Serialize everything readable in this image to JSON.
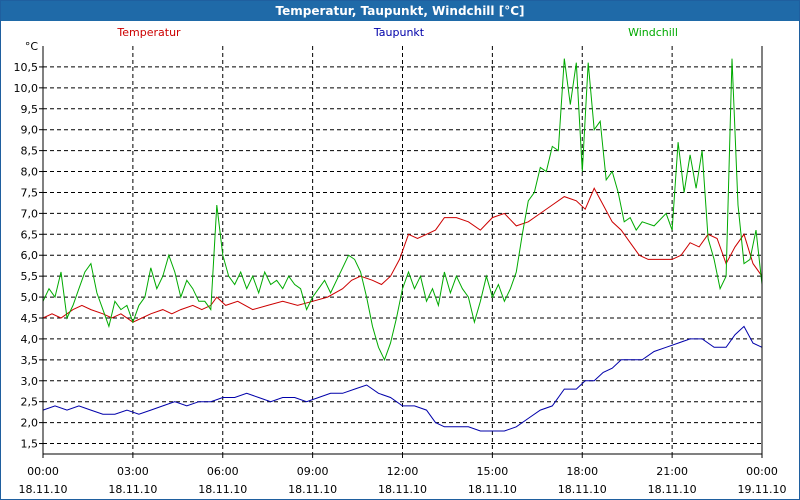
{
  "window_title": "Temperatur, Taupunkt, Windchill [°C]",
  "chart_data": {
    "type": "line",
    "title": "Temperatur, Taupunkt, Windchill [°C]",
    "ylabel": "°C",
    "ylim": [
      1.25,
      11.0
    ],
    "yticks": [
      1.5,
      2.0,
      2.5,
      3.0,
      3.5,
      4.0,
      4.5,
      5.0,
      5.5,
      6.0,
      6.5,
      7.0,
      7.5,
      8.0,
      8.5,
      9.0,
      9.5,
      10.0,
      10.5
    ],
    "ytick_labels": [
      "1,5",
      "2,0",
      "2,5",
      "3,0",
      "3,5",
      "4,0",
      "4,5",
      "5,0",
      "5,5",
      "6,0",
      "6,5",
      "7,0",
      "7,5",
      "8,0",
      "8,5",
      "9,0",
      "9,5",
      "10,0",
      "10,5"
    ],
    "xlim_hours": [
      0,
      24
    ],
    "xticks": [
      {
        "h": 0,
        "time": "00:00",
        "date": "18.11.10"
      },
      {
        "h": 3,
        "time": "03:00",
        "date": "18.11.10"
      },
      {
        "h": 6,
        "time": "06:00",
        "date": "18.11.10"
      },
      {
        "h": 9,
        "time": "09:00",
        "date": "18.11.10"
      },
      {
        "h": 12,
        "time": "12:00",
        "date": "18.11.10"
      },
      {
        "h": 15,
        "time": "15:00",
        "date": "18.11.10"
      },
      {
        "h": 18,
        "time": "18:00",
        "date": "18.11.10"
      },
      {
        "h": 21,
        "time": "21:00",
        "date": "18.11.10"
      },
      {
        "h": 24,
        "time": "00:00",
        "date": "19.11.10"
      }
    ],
    "grid": true,
    "legend": "top",
    "series": [
      {
        "name": "Temperatur",
        "color": "#cc0000",
        "points": [
          [
            0,
            4.5
          ],
          [
            0.3,
            4.6
          ],
          [
            0.6,
            4.5
          ],
          [
            1,
            4.7
          ],
          [
            1.3,
            4.8
          ],
          [
            1.6,
            4.7
          ],
          [
            2,
            4.6
          ],
          [
            2.3,
            4.5
          ],
          [
            2.6,
            4.6
          ],
          [
            3,
            4.4
          ],
          [
            3.3,
            4.5
          ],
          [
            3.6,
            4.6
          ],
          [
            4,
            4.7
          ],
          [
            4.3,
            4.6
          ],
          [
            4.6,
            4.7
          ],
          [
            5,
            4.8
          ],
          [
            5.3,
            4.7
          ],
          [
            5.6,
            4.8
          ],
          [
            5.8,
            5.0
          ],
          [
            6.1,
            4.8
          ],
          [
            6.5,
            4.9
          ],
          [
            7,
            4.7
          ],
          [
            7.5,
            4.8
          ],
          [
            8,
            4.9
          ],
          [
            8.5,
            4.8
          ],
          [
            9,
            4.9
          ],
          [
            9.5,
            5.0
          ],
          [
            10,
            5.2
          ],
          [
            10.3,
            5.4
          ],
          [
            10.6,
            5.5
          ],
          [
            11,
            5.4
          ],
          [
            11.3,
            5.3
          ],
          [
            11.6,
            5.5
          ],
          [
            11.9,
            5.9
          ],
          [
            12.2,
            6.5
          ],
          [
            12.5,
            6.4
          ],
          [
            12.8,
            6.5
          ],
          [
            13.1,
            6.6
          ],
          [
            13.4,
            6.9
          ],
          [
            13.8,
            6.9
          ],
          [
            14.2,
            6.8
          ],
          [
            14.6,
            6.6
          ],
          [
            15,
            6.9
          ],
          [
            15.4,
            7.0
          ],
          [
            15.8,
            6.7
          ],
          [
            16.2,
            6.8
          ],
          [
            16.6,
            7.0
          ],
          [
            17,
            7.2
          ],
          [
            17.4,
            7.4
          ],
          [
            17.8,
            7.3
          ],
          [
            18.1,
            7.1
          ],
          [
            18.4,
            7.6
          ],
          [
            18.7,
            7.2
          ],
          [
            19,
            6.8
          ],
          [
            19.3,
            6.6
          ],
          [
            19.6,
            6.3
          ],
          [
            19.9,
            6.0
          ],
          [
            20.2,
            5.9
          ],
          [
            20.6,
            5.9
          ],
          [
            21,
            5.9
          ],
          [
            21.3,
            6.0
          ],
          [
            21.6,
            6.3
          ],
          [
            21.9,
            6.2
          ],
          [
            22.2,
            6.5
          ],
          [
            22.5,
            6.4
          ],
          [
            22.8,
            5.8
          ],
          [
            23.1,
            6.2
          ],
          [
            23.4,
            6.5
          ],
          [
            23.7,
            5.8
          ],
          [
            24,
            5.5
          ]
        ]
      },
      {
        "name": "Taupunkt",
        "color": "#0000aa",
        "points": [
          [
            0,
            2.3
          ],
          [
            0.4,
            2.4
          ],
          [
            0.8,
            2.3
          ],
          [
            1.2,
            2.4
          ],
          [
            1.6,
            2.3
          ],
          [
            2,
            2.2
          ],
          [
            2.4,
            2.2
          ],
          [
            2.8,
            2.3
          ],
          [
            3.2,
            2.2
          ],
          [
            3.6,
            2.3
          ],
          [
            4,
            2.4
          ],
          [
            4.4,
            2.5
          ],
          [
            4.8,
            2.4
          ],
          [
            5.2,
            2.5
          ],
          [
            5.6,
            2.5
          ],
          [
            6,
            2.6
          ],
          [
            6.4,
            2.6
          ],
          [
            6.8,
            2.7
          ],
          [
            7.2,
            2.6
          ],
          [
            7.6,
            2.5
          ],
          [
            8,
            2.6
          ],
          [
            8.4,
            2.6
          ],
          [
            8.8,
            2.5
          ],
          [
            9.2,
            2.6
          ],
          [
            9.6,
            2.7
          ],
          [
            10,
            2.7
          ],
          [
            10.4,
            2.8
          ],
          [
            10.8,
            2.9
          ],
          [
            11.2,
            2.7
          ],
          [
            11.6,
            2.6
          ],
          [
            12,
            2.4
          ],
          [
            12.4,
            2.4
          ],
          [
            12.8,
            2.3
          ],
          [
            13.1,
            2.0
          ],
          [
            13.4,
            1.9
          ],
          [
            13.8,
            1.9
          ],
          [
            14.2,
            1.9
          ],
          [
            14.6,
            1.8
          ],
          [
            15,
            1.8
          ],
          [
            15.4,
            1.8
          ],
          [
            15.8,
            1.9
          ],
          [
            16.2,
            2.1
          ],
          [
            16.6,
            2.3
          ],
          [
            17,
            2.4
          ],
          [
            17.4,
            2.8
          ],
          [
            17.8,
            2.8
          ],
          [
            18.1,
            3.0
          ],
          [
            18.4,
            3.0
          ],
          [
            18.7,
            3.2
          ],
          [
            19,
            3.3
          ],
          [
            19.3,
            3.5
          ],
          [
            19.6,
            3.5
          ],
          [
            20,
            3.5
          ],
          [
            20.4,
            3.7
          ],
          [
            20.8,
            3.8
          ],
          [
            21.2,
            3.9
          ],
          [
            21.6,
            4.0
          ],
          [
            22,
            4.0
          ],
          [
            22.4,
            3.8
          ],
          [
            22.8,
            3.8
          ],
          [
            23.1,
            4.1
          ],
          [
            23.4,
            4.3
          ],
          [
            23.7,
            3.9
          ],
          [
            24,
            3.8
          ]
        ]
      },
      {
        "name": "Windchill",
        "color": "#00aa00",
        "points": [
          [
            0,
            4.9
          ],
          [
            0.2,
            5.2
          ],
          [
            0.4,
            5.0
          ],
          [
            0.6,
            5.6
          ],
          [
            0.8,
            4.5
          ],
          [
            1,
            4.8
          ],
          [
            1.2,
            5.2
          ],
          [
            1.4,
            5.6
          ],
          [
            1.6,
            5.8
          ],
          [
            1.8,
            5.1
          ],
          [
            2,
            4.7
          ],
          [
            2.2,
            4.3
          ],
          [
            2.4,
            4.9
          ],
          [
            2.6,
            4.7
          ],
          [
            2.8,
            4.8
          ],
          [
            3,
            4.4
          ],
          [
            3.2,
            4.8
          ],
          [
            3.4,
            5.0
          ],
          [
            3.6,
            5.7
          ],
          [
            3.8,
            5.2
          ],
          [
            4,
            5.5
          ],
          [
            4.2,
            6.0
          ],
          [
            4.4,
            5.6
          ],
          [
            4.6,
            5.0
          ],
          [
            4.8,
            5.4
          ],
          [
            5,
            5.2
          ],
          [
            5.2,
            4.9
          ],
          [
            5.4,
            4.9
          ],
          [
            5.6,
            4.7
          ],
          [
            5.8,
            7.2
          ],
          [
            6,
            6.0
          ],
          [
            6.2,
            5.5
          ],
          [
            6.4,
            5.3
          ],
          [
            6.6,
            5.6
          ],
          [
            6.8,
            5.2
          ],
          [
            7,
            5.5
          ],
          [
            7.2,
            5.1
          ],
          [
            7.4,
            5.6
          ],
          [
            7.6,
            5.3
          ],
          [
            7.8,
            5.4
          ],
          [
            8,
            5.2
          ],
          [
            8.2,
            5.5
          ],
          [
            8.4,
            5.3
          ],
          [
            8.6,
            5.2
          ],
          [
            8.8,
            4.7
          ],
          [
            9,
            5.0
          ],
          [
            9.2,
            5.2
          ],
          [
            9.4,
            5.4
          ],
          [
            9.6,
            5.1
          ],
          [
            9.8,
            5.4
          ],
          [
            10,
            5.7
          ],
          [
            10.2,
            6.0
          ],
          [
            10.4,
            5.9
          ],
          [
            10.6,
            5.6
          ],
          [
            10.8,
            5.0
          ],
          [
            11,
            4.3
          ],
          [
            11.2,
            3.8
          ],
          [
            11.4,
            3.5
          ],
          [
            11.6,
            3.9
          ],
          [
            11.8,
            4.5
          ],
          [
            12,
            5.2
          ],
          [
            12.2,
            5.6
          ],
          [
            12.4,
            5.2
          ],
          [
            12.6,
            5.5
          ],
          [
            12.8,
            4.9
          ],
          [
            13,
            5.2
          ],
          [
            13.2,
            4.8
          ],
          [
            13.4,
            5.6
          ],
          [
            13.6,
            5.1
          ],
          [
            13.8,
            5.5
          ],
          [
            14,
            5.2
          ],
          [
            14.2,
            5.0
          ],
          [
            14.4,
            4.4
          ],
          [
            14.6,
            4.9
          ],
          [
            14.8,
            5.5
          ],
          [
            15,
            5.0
          ],
          [
            15.2,
            5.3
          ],
          [
            15.4,
            4.9
          ],
          [
            15.6,
            5.2
          ],
          [
            15.8,
            5.6
          ],
          [
            16,
            6.5
          ],
          [
            16.2,
            7.3
          ],
          [
            16.4,
            7.5
          ],
          [
            16.6,
            8.1
          ],
          [
            16.8,
            8.0
          ],
          [
            17,
            8.6
          ],
          [
            17.2,
            8.5
          ],
          [
            17.4,
            10.7
          ],
          [
            17.6,
            9.6
          ],
          [
            17.8,
            10.6
          ],
          [
            18,
            8.0
          ],
          [
            18.2,
            10.6
          ],
          [
            18.4,
            9.0
          ],
          [
            18.6,
            9.2
          ],
          [
            18.8,
            7.8
          ],
          [
            19,
            8.0
          ],
          [
            19.2,
            7.5
          ],
          [
            19.4,
            6.8
          ],
          [
            19.6,
            6.9
          ],
          [
            19.8,
            6.6
          ],
          [
            20,
            6.8
          ],
          [
            20.4,
            6.7
          ],
          [
            20.8,
            7.0
          ],
          [
            21,
            6.6
          ],
          [
            21.2,
            8.7
          ],
          [
            21.4,
            7.5
          ],
          [
            21.6,
            8.4
          ],
          [
            21.8,
            7.6
          ],
          [
            22,
            8.5
          ],
          [
            22.2,
            6.4
          ],
          [
            22.4,
            5.9
          ],
          [
            22.6,
            5.2
          ],
          [
            22.8,
            5.5
          ],
          [
            23,
            10.7
          ],
          [
            23.2,
            7.2
          ],
          [
            23.4,
            5.8
          ],
          [
            23.6,
            5.9
          ],
          [
            23.8,
            6.6
          ],
          [
            24,
            5.3
          ]
        ]
      }
    ]
  }
}
